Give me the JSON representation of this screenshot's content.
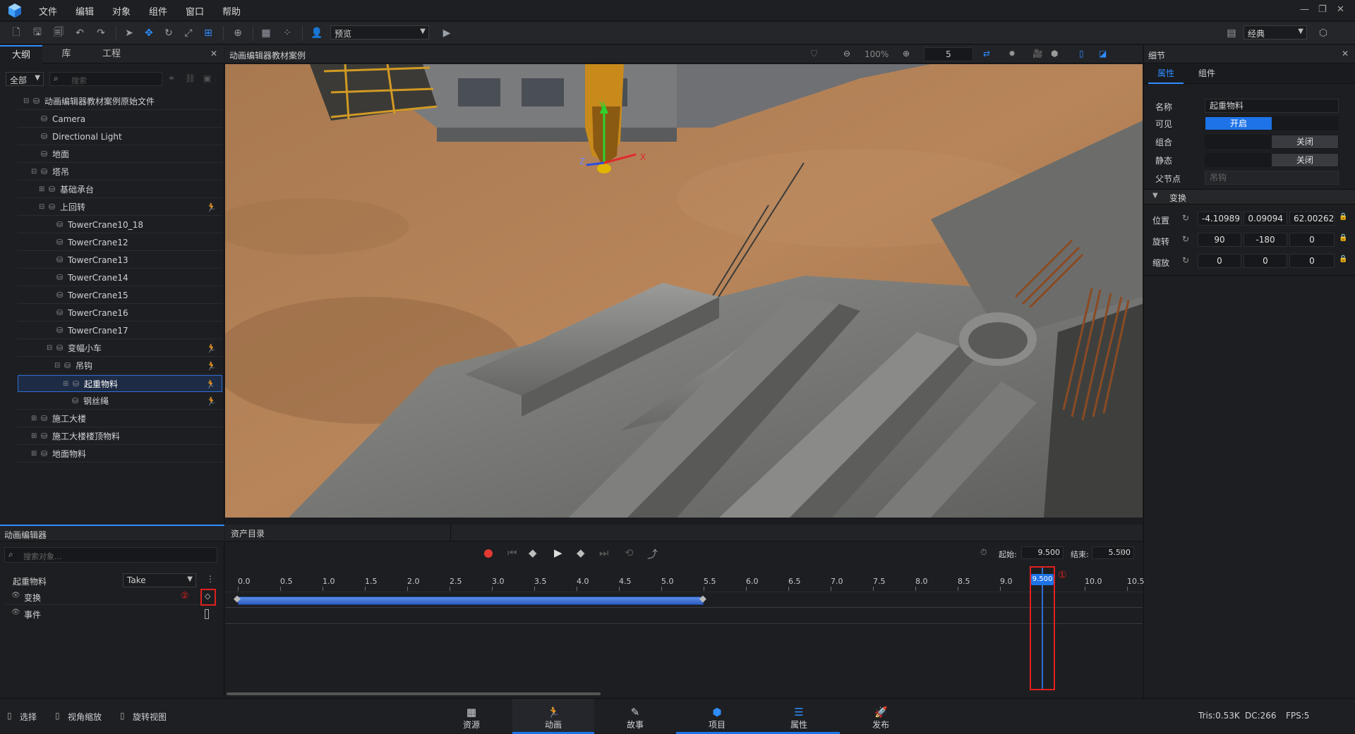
{
  "menu": [
    "文件",
    "编辑",
    "对象",
    "组件",
    "窗口",
    "帮助"
  ],
  "toolbar": {
    "view_mode": "预览",
    "layout_mode": "经典"
  },
  "outline": {
    "tabs": [
      "大纲",
      "库",
      "工程"
    ],
    "filter": "全部",
    "search_placeholder": "搜索",
    "items": [
      {
        "label": "动画编辑器教材案例原始文件",
        "depth": 0,
        "exp": "⊟",
        "anim": false,
        "sel": false
      },
      {
        "label": "Camera",
        "depth": 1,
        "exp": "",
        "anim": false,
        "sel": false
      },
      {
        "label": "Directional Light",
        "depth": 1,
        "exp": "",
        "anim": false,
        "sel": false
      },
      {
        "label": "地面",
        "depth": 1,
        "exp": "",
        "anim": false,
        "sel": false
      },
      {
        "label": "塔吊",
        "depth": 1,
        "exp": "⊟",
        "anim": false,
        "sel": false
      },
      {
        "label": "基础承台",
        "depth": 2,
        "exp": "⊞",
        "anim": false,
        "sel": false
      },
      {
        "label": "上回转",
        "depth": 2,
        "exp": "⊟",
        "anim": true,
        "sel": false
      },
      {
        "label": "TowerCrane10_18",
        "depth": 3,
        "exp": "",
        "anim": false,
        "sel": false
      },
      {
        "label": "TowerCrane12",
        "depth": 3,
        "exp": "",
        "anim": false,
        "sel": false
      },
      {
        "label": "TowerCrane13",
        "depth": 3,
        "exp": "",
        "anim": false,
        "sel": false
      },
      {
        "label": "TowerCrane14",
        "depth": 3,
        "exp": "",
        "anim": false,
        "sel": false
      },
      {
        "label": "TowerCrane15",
        "depth": 3,
        "exp": "",
        "anim": false,
        "sel": false
      },
      {
        "label": "TowerCrane16",
        "depth": 3,
        "exp": "",
        "anim": false,
        "sel": false
      },
      {
        "label": "TowerCrane17",
        "depth": 3,
        "exp": "",
        "anim": false,
        "sel": false
      },
      {
        "label": "变幅小车",
        "depth": 3,
        "exp": "⊟",
        "anim": true,
        "sel": false
      },
      {
        "label": "吊钩",
        "depth": 4,
        "exp": "⊟",
        "anim": true,
        "sel": false
      },
      {
        "label": "起重物料",
        "depth": 5,
        "exp": "⊞",
        "anim": true,
        "sel": true
      },
      {
        "label": "钢丝绳",
        "depth": 5,
        "exp": "",
        "anim": true,
        "sel": false
      },
      {
        "label": "施工大楼",
        "depth": 1,
        "exp": "⊞",
        "anim": false,
        "sel": false
      },
      {
        "label": "施工大楼楼顶物料",
        "depth": 1,
        "exp": "⊞",
        "anim": false,
        "sel": false
      },
      {
        "label": "地面物料",
        "depth": 1,
        "exp": "⊞",
        "anim": false,
        "sel": false
      }
    ]
  },
  "viewport": {
    "title": "动画编辑器教材案例",
    "zoom": "100%",
    "speed": "5",
    "axis_x": "X",
    "axis_y": "Y",
    "axis_z": "Z"
  },
  "details": {
    "title": "细节",
    "tabs": [
      "属性",
      "组件"
    ],
    "name_label": "名称",
    "name_value": "起重物料",
    "visible_label": "可见",
    "visible_value": "开启",
    "group_label": "组合",
    "group_value": "关闭",
    "static_label": "静态",
    "static_value": "关闭",
    "parent_label": "父节点",
    "parent_value": "吊钩",
    "transform_section": "变换",
    "position_label": "位置",
    "position": [
      "-4.10989",
      "0.09094",
      "62.00262"
    ],
    "rotation_label": "旋转",
    "rotation": [
      "90",
      "-180",
      "0"
    ],
    "scale_label": "缩放",
    "scale": [
      "0",
      "0",
      "0"
    ]
  },
  "anim_editor": {
    "title": "动画编辑器",
    "search_placeholder": "搜索对象...",
    "object": "起重物料",
    "take": "Take",
    "tracks": [
      "变换",
      "事件"
    ],
    "assets_tab": "资产目录",
    "start_label": "起始:",
    "start_value": "9.500",
    "end_label": "结束:",
    "end_value": "5.500",
    "ticks": [
      "0.0",
      "0.5",
      "1.0",
      "1.5",
      "2.0",
      "2.5",
      "3.0",
      "3.5",
      "4.0",
      "4.5",
      "5.0",
      "5.5",
      "6.0",
      "6.5",
      "7.0",
      "7.5",
      "8.0",
      "8.5",
      "9.0",
      "9.5",
      "10.0",
      "10.5"
    ],
    "playhead": "9.500",
    "clip_start": 0.0,
    "clip_end": 5.5,
    "playhead_value": 9.5,
    "marker1": "①",
    "marker2": "②"
  },
  "status": {
    "left": [
      "选择",
      "视角缩放",
      "旋转视图"
    ],
    "tabs": [
      "资源",
      "动画",
      "故事",
      "项目",
      "属性",
      "发布"
    ],
    "active_tab": "动画",
    "tris": "Tris:0.53K",
    "dc": "DC:266",
    "fps": "FPS:5"
  },
  "colors": {
    "accent": "#1e73e8",
    "selection": "#2e6fd6",
    "highlight_box": "#e0201e",
    "record": "#e53935"
  }
}
